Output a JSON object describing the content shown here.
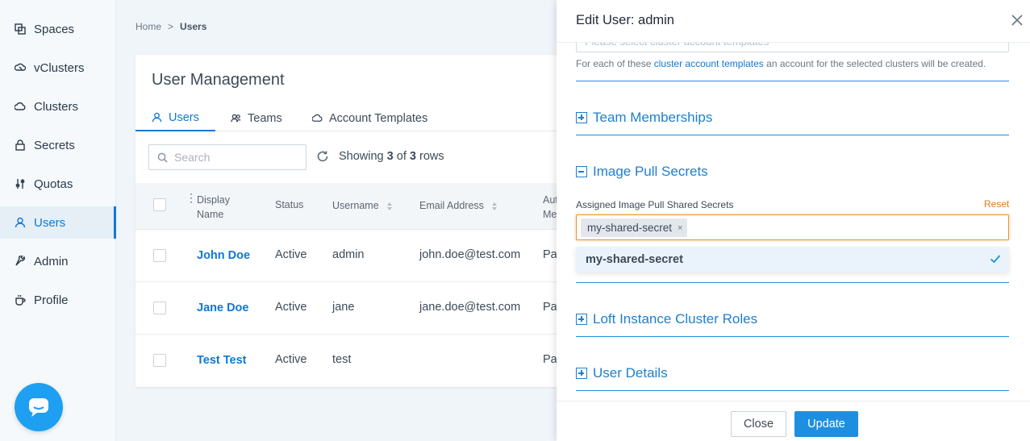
{
  "sidebar": {
    "items": [
      {
        "label": "Spaces",
        "icon": "spaces-icon"
      },
      {
        "label": "vClusters",
        "icon": "vcluster-icon"
      },
      {
        "label": "Clusters",
        "icon": "cloud-icon"
      },
      {
        "label": "Secrets",
        "icon": "lock-icon"
      },
      {
        "label": "Quotas",
        "icon": "sliders-icon"
      },
      {
        "label": "Users",
        "icon": "user-icon",
        "active": true
      },
      {
        "label": "Admin",
        "icon": "wrench-icon"
      },
      {
        "label": "Profile",
        "icon": "coffee-icon"
      }
    ]
  },
  "breadcrumb": {
    "home": "Home",
    "separator": ">",
    "current": "Users"
  },
  "card": {
    "title": "User Management",
    "tabs": [
      {
        "label": "Users",
        "active": true
      },
      {
        "label": "Teams"
      },
      {
        "label": "Account Templates"
      }
    ],
    "search_placeholder": "Search",
    "rows_info": {
      "prefix": "Showing",
      "shown": "3",
      "of": "of",
      "total": "3",
      "suffix": "rows"
    },
    "columns": {
      "display_name_1": "Display",
      "display_name_2": "Name",
      "status": "Status",
      "username": "Username",
      "email": "Email Address",
      "auth_1": "Aut",
      "auth_2": "Me"
    },
    "rows": [
      {
        "name": "John Doe",
        "status": "Active",
        "username": "admin",
        "email": "john.doe@test.com",
        "auth": "Pa"
      },
      {
        "name": "Jane Doe",
        "status": "Active",
        "username": "jane",
        "email": "jane.doe@test.com",
        "auth": "Pa"
      },
      {
        "name": "Test Test",
        "status": "Active",
        "username": "test",
        "email": "",
        "auth": "Pa"
      }
    ]
  },
  "drawer": {
    "title": "Edit User: admin",
    "faded_placeholder": "Please select cluster account templates",
    "help": {
      "before": "For each of these ",
      "link": "cluster account templates",
      "after": " an account for the selected clusters will be created."
    },
    "sections": {
      "team_memberships": "Team Memberships",
      "image_pull_secrets": "Image Pull Secrets",
      "cluster_roles": "Loft Instance Cluster Roles",
      "user_details": "User Details"
    },
    "field_label": "Assigned Image Pull Shared Secrets",
    "reset_label": "Reset",
    "selected_tag": "my-shared-secret",
    "tag_remove": "×",
    "dropdown_option": "my-shared-secret",
    "close_label": "Close",
    "update_label": "Update"
  },
  "colors": {
    "accent": "#1e8ee0",
    "focus": "#e8922b",
    "reset": "#e07b16"
  }
}
